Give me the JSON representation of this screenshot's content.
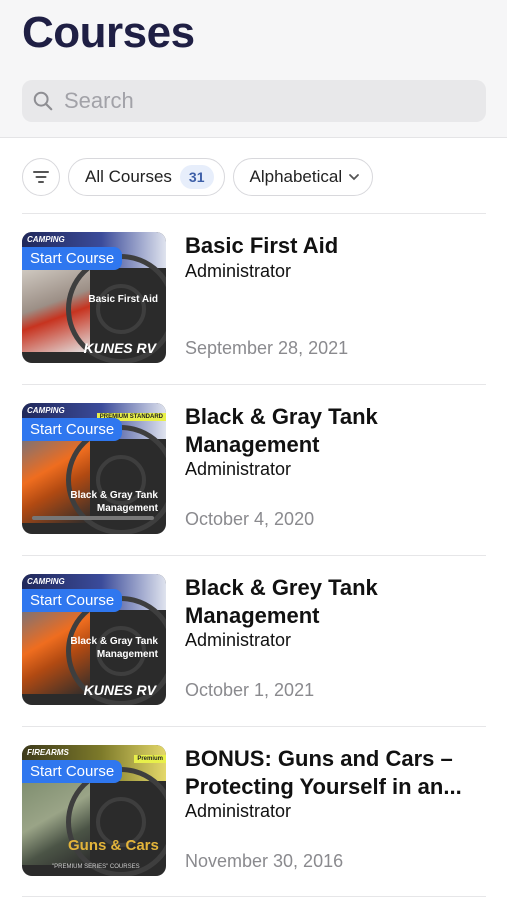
{
  "header": {
    "title": "Courses",
    "search": {
      "placeholder": "Search",
      "value": ""
    }
  },
  "filters": {
    "filter_icon": "filter-lines-icon",
    "category_label": "All Courses",
    "category_count": "31",
    "sort_label": "Alphabetical",
    "sort_icon": "chevron-down-icon"
  },
  "courses": [
    {
      "title": "Basic First Aid",
      "author": "Administrator",
      "date": "September 28, 2021",
      "badge": "Start Course",
      "thumb_text": "Basic First Aid",
      "thumb_brand": "KUNES RV",
      "thumb_logo": "CAMPING"
    },
    {
      "title": "Black & Gray Tank Management",
      "author": "Administrator",
      "date": "October 4, 2020",
      "badge": "Start Course",
      "thumb_text": "Black & Gray Tank Management",
      "thumb_tag": "PREMIUM STANDARD",
      "thumb_logo": "CAMPING"
    },
    {
      "title": "Black & Grey Tank Management",
      "author": "Administrator",
      "date": "October 1, 2021",
      "badge": "Start Course",
      "thumb_text": "Black & Gray Tank Management",
      "thumb_brand": "KUNES RV",
      "thumb_logo": "CAMPING"
    },
    {
      "title": "BONUS: Guns and Cars – Protecting Yourself in an...",
      "author": "Administrator",
      "date": "November 30, 2016",
      "badge": "Start Course",
      "thumb_text": "Guns & Cars",
      "thumb_sub": "\"PREMIUM SERIES\" COURSES",
      "thumb_tag": "Premium",
      "thumb_logo": "FIREARMS"
    }
  ],
  "colors": {
    "title": "#1f1f44",
    "badge_blue": "#2f77ef",
    "date_gray": "#8a8a8e"
  }
}
